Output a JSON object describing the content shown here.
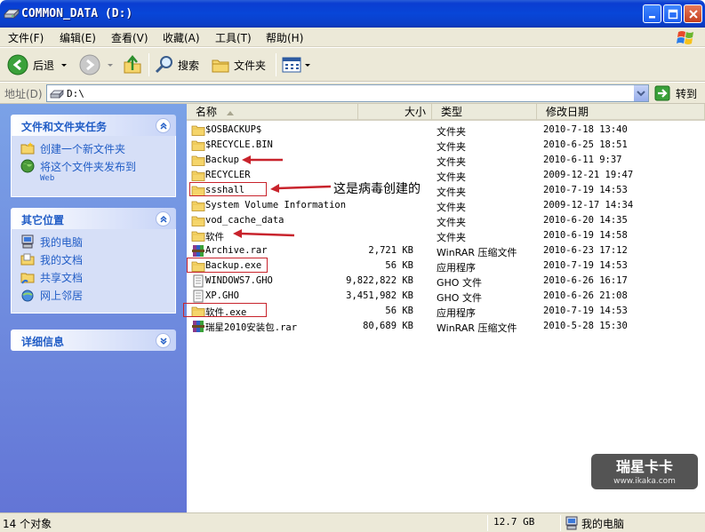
{
  "window": {
    "title": "COMMON_DATA (D:)"
  },
  "menu": [
    "文件(F)",
    "编辑(E)",
    "查看(V)",
    "收藏(A)",
    "工具(T)",
    "帮助(H)"
  ],
  "toolbar": {
    "back": "后退",
    "search": "搜索",
    "folders": "文件夹"
  },
  "address": {
    "label": "地址(D)",
    "value": "D:\\",
    "go": "转到"
  },
  "left_pane": {
    "tasks_title": "文件和文件夹任务",
    "task_new_folder": "创建一个新文件夹",
    "task_publish": "将这个文件夹发布到",
    "task_publish_sub": "Web",
    "places_title": "其它位置",
    "places": [
      "我的电脑",
      "我的文档",
      "共享文档",
      "网上邻居"
    ],
    "details_title": "详细信息"
  },
  "columns": {
    "name": "名称",
    "size": "大小",
    "type": "类型",
    "date": "修改日期"
  },
  "files": [
    {
      "name": "$OSBACKUP$",
      "size": "",
      "type": "文件夹",
      "date": "2010-7-18 13:40",
      "icon": "folder"
    },
    {
      "name": "$RECYCLE.BIN",
      "size": "",
      "type": "文件夹",
      "date": "2010-6-25 18:51",
      "icon": "folder"
    },
    {
      "name": "Backup",
      "size": "",
      "type": "文件夹",
      "date": "2010-6-11 9:37",
      "icon": "folder"
    },
    {
      "name": "RECYCLER",
      "size": "",
      "type": "文件夹",
      "date": "2009-12-21 19:47",
      "icon": "folder"
    },
    {
      "name": "ssshall",
      "size": "",
      "type": "文件夹",
      "date": "2010-7-19 14:53",
      "icon": "folder"
    },
    {
      "name": "System Volume Information",
      "size": "",
      "type": "文件夹",
      "date": "2009-12-17 14:34",
      "icon": "folder"
    },
    {
      "name": "vod_cache_data",
      "size": "",
      "type": "文件夹",
      "date": "2010-6-20 14:35",
      "icon": "folder"
    },
    {
      "name": "软件",
      "size": "",
      "type": "文件夹",
      "date": "2010-6-19 14:58",
      "icon": "folder"
    },
    {
      "name": "Archive.rar",
      "size": "2,721 KB",
      "type": "WinRAR 压缩文件",
      "date": "2010-6-23 17:12",
      "icon": "rar"
    },
    {
      "name": "Backup.exe",
      "size": "56 KB",
      "type": "应用程序",
      "date": "2010-7-19 14:53",
      "icon": "folder"
    },
    {
      "name": "WINDOWS7.GHO",
      "size": "9,822,822 KB",
      "type": "GHO 文件",
      "date": "2010-6-26 16:17",
      "icon": "gho"
    },
    {
      "name": "XP.GHO",
      "size": "3,451,982 KB",
      "type": "GHO 文件",
      "date": "2010-6-26 21:08",
      "icon": "gho"
    },
    {
      "name": "软件.exe",
      "size": "56 KB",
      "type": "应用程序",
      "date": "2010-7-19 14:53",
      "icon": "folder"
    },
    {
      "name": "瑞星2010安装包.rar",
      "size": "80,689 KB",
      "type": "WinRAR 压缩文件",
      "date": "2010-5-28 15:30",
      "icon": "rar"
    }
  ],
  "annotation": "这是病毒创建的",
  "watermark": {
    "title": "瑞星卡卡",
    "url": "www.ikaka.com"
  },
  "status": {
    "count": "14 个对象",
    "size": "12.7 GB",
    "location": "我的电脑"
  },
  "colors": {
    "title_bar": "#0a46d8",
    "left_pane": "#7ba2e7",
    "annotation": "#c8232c",
    "link": "#215dc6"
  }
}
